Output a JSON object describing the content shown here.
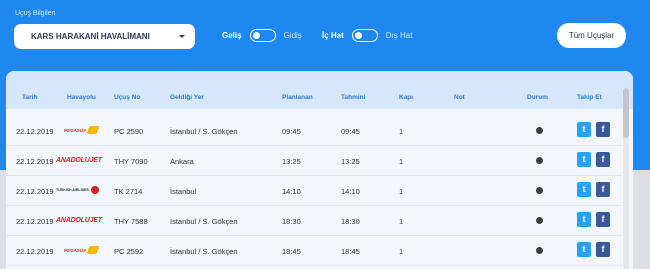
{
  "header": {
    "section_label": "Uçuş Bilgileri",
    "airport_select": "KARS HARAKANİ HAVALİMANI",
    "direction_toggle": {
      "on_label": "Geliş",
      "off_label": "Gidiş"
    },
    "scope_toggle": {
      "on_label": "İç Hat",
      "off_label": "Dış Hat"
    },
    "all_flights_button": "Tüm Uçuşlar"
  },
  "table": {
    "columns": [
      "Tarih",
      "Havayolu",
      "Uçuş No",
      "Geldiği Yer",
      "Planlanan",
      "Tahmini",
      "Kapı",
      "Not",
      "Durum",
      "Takip Et"
    ],
    "rows": [
      {
        "date": "22.12.2019",
        "airline_logo": "PEGASUS",
        "flight_no": "PC 2590",
        "origin": "İstanbul / S. Gökçen",
        "planned": "09:45",
        "estimated": "09:45",
        "gate": "1",
        "note": ""
      },
      {
        "date": "22.12.2019",
        "airline_logo": "ANADOLUJET",
        "flight_no": "THY 7090",
        "origin": "Ankara",
        "planned": "13:25",
        "estimated": "13:25",
        "gate": "1",
        "note": ""
      },
      {
        "date": "22.12.2019",
        "airline_logo": "TURKISH AIRLINES",
        "flight_no": "TK 2714",
        "origin": "İstanbul",
        "planned": "14:10",
        "estimated": "14:10",
        "gate": "1",
        "note": ""
      },
      {
        "date": "22.12.2019",
        "airline_logo": "ANADOLUJET",
        "flight_no": "THY 7588",
        "origin": "İstanbul / S. Gökçen",
        "planned": "18:30",
        "estimated": "18:30",
        "gate": "1",
        "note": ""
      },
      {
        "date": "22.12.2019",
        "airline_logo": "PEGASUS",
        "flight_no": "PC 2592",
        "origin": "İstanbul / S. Gökçen",
        "planned": "18:45",
        "estimated": "18:45",
        "gate": "1",
        "note": ""
      }
    ]
  },
  "icons": {
    "twitter": "twitter-icon",
    "facebook": "facebook-icon",
    "status": "status-dot-icon"
  },
  "colors": {
    "primary_blue": "#1e88f0",
    "header_text": "#2e78d4",
    "twitter": "#2aa3ef",
    "facebook": "#3b5998"
  }
}
